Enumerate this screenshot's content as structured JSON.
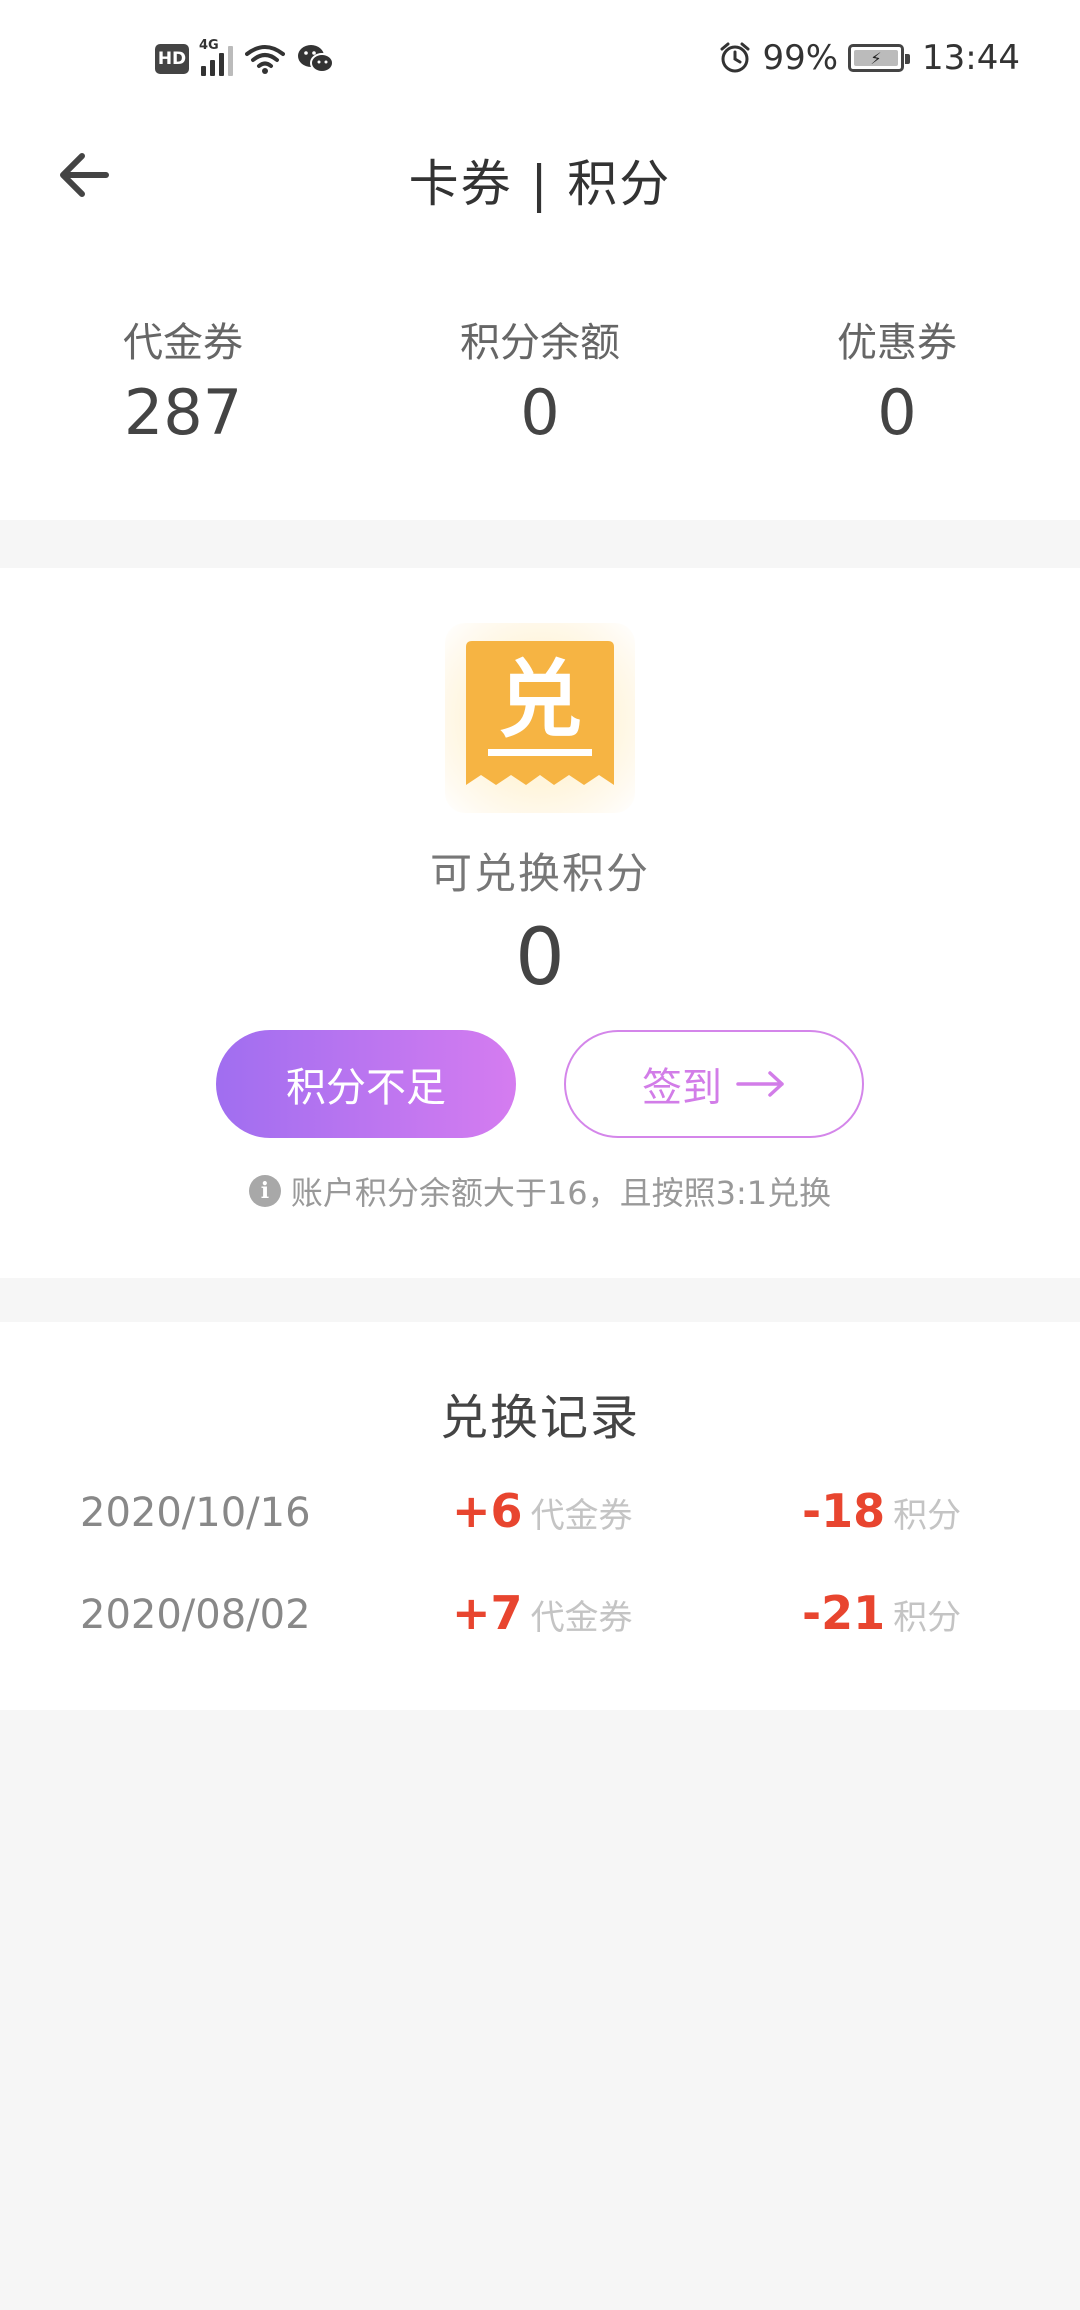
{
  "status_bar": {
    "hd": "HD",
    "network": "4G",
    "battery_percent": "99%",
    "battery_level": 0.99,
    "time": "13:44",
    "icons": [
      "hd-icon",
      "signal-icon",
      "wifi-icon",
      "wechat-icon",
      "alarm-icon",
      "battery-icon"
    ]
  },
  "nav": {
    "title": "卡券 | 积分",
    "back_icon": "arrow-left-icon"
  },
  "summary": {
    "items": [
      {
        "label": "代金券",
        "value": "287"
      },
      {
        "label": "积分余额",
        "value": "0"
      },
      {
        "label": "优惠券",
        "value": "0"
      }
    ]
  },
  "exchange": {
    "icon_char": "兑",
    "label": "可兑换积分",
    "value": "0",
    "insufficient_button": "积分不足",
    "signin_button": "签到",
    "hint": "账户积分余额大于16，且按照3:1兑换",
    "info_icon_char": "i"
  },
  "records": {
    "title": "兑换记录",
    "rows": [
      {
        "date": "2020/10/16",
        "amount": "+6",
        "amount_unit": "代金券",
        "points": "-18",
        "points_unit": "积分"
      },
      {
        "date": "2020/08/02",
        "amount": "+7",
        "amount_unit": "代金券",
        "points": "-21",
        "points_unit": "积分"
      }
    ]
  },
  "colors": {
    "accent_red": "#e8452f",
    "button_gradient_start": "#a06ef0",
    "button_gradient_end": "#d57cf0",
    "signin_outline": "#d486ea",
    "exchange_icon": "#f6b443"
  }
}
